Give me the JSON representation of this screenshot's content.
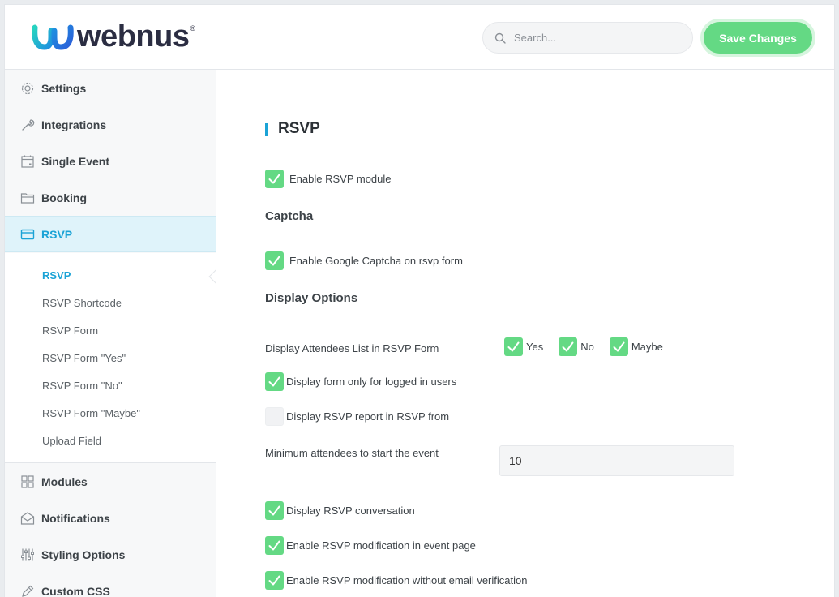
{
  "brand": {
    "name": "webnus",
    "reg": "®"
  },
  "header": {
    "search_placeholder": "Search...",
    "save_label": "Save Changes"
  },
  "sidebar": {
    "items": [
      {
        "label": "Settings",
        "icon": "gear-icon"
      },
      {
        "label": "Integrations",
        "icon": "wrench-icon"
      },
      {
        "label": "Single Event",
        "icon": "calendar-icon"
      },
      {
        "label": "Booking",
        "icon": "folder-icon"
      },
      {
        "label": "RSVP",
        "icon": "card-icon"
      },
      {
        "label": "Modules",
        "icon": "grid-icon"
      },
      {
        "label": "Notifications",
        "icon": "envelope-icon"
      },
      {
        "label": "Styling Options",
        "icon": "sliders-icon"
      },
      {
        "label": "Custom CSS",
        "icon": "pencil-icon"
      }
    ],
    "active_index": 4,
    "submenu": [
      "RSVP",
      "RSVP Shortcode",
      "RSVP Form",
      "RSVP Form \"Yes\"",
      "RSVP Form \"No\"",
      "RSVP Form \"Maybe\"",
      "Upload Field"
    ],
    "submenu_active_index": 0
  },
  "main": {
    "title": "RSVP",
    "enable_rsvp": {
      "label": "Enable RSVP module",
      "checked": true
    },
    "captcha_heading": "Captcha",
    "captcha": {
      "label": "Enable Google Captcha on rsvp form",
      "checked": true
    },
    "display_heading": "Display Options",
    "attendees": {
      "label": "Display Attendees List in RSVP Form",
      "options": [
        {
          "label": "Yes",
          "checked": true
        },
        {
          "label": "No",
          "checked": true
        },
        {
          "label": "Maybe",
          "checked": true
        }
      ]
    },
    "logged_in": {
      "label": "Display form only for logged in users",
      "checked": true
    },
    "report": {
      "label": "Display RSVP report in RSVP from",
      "checked": false
    },
    "min_attendees": {
      "label": "Minimum attendees to start the event",
      "value": "10"
    },
    "conversation": {
      "label": "Display RSVP conversation",
      "checked": true
    },
    "modification": {
      "label": "Enable RSVP modification in event page",
      "checked": true
    },
    "no_email": {
      "label": "Enable RSVP modification without email verification",
      "checked": true
    }
  },
  "colors": {
    "accent": "#1ba3d6",
    "check_green": "#64d984",
    "save_green": "#64d984"
  }
}
